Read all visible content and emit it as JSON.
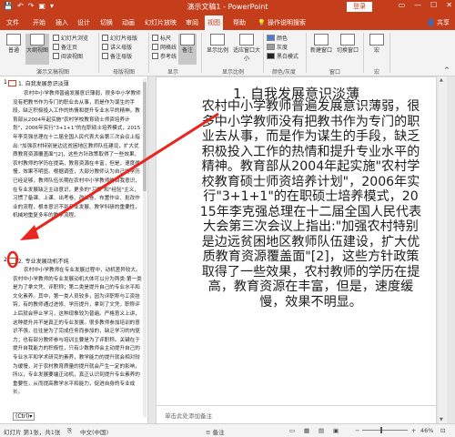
{
  "titlebar": {
    "title": "演示文稿1 - PowerPoint",
    "quick_access": [
      "💾",
      "↶",
      "↷",
      "▣",
      "▾"
    ],
    "login": "登录",
    "controls": [
      "▭",
      "—",
      "☐",
      "✕"
    ]
  },
  "tabs": {
    "items": [
      "文件",
      "开始",
      "插入",
      "设计",
      "切换",
      "动画",
      "幻灯片放映",
      "审阅",
      "视图",
      "帮助"
    ],
    "active": "视图",
    "tell_me": "操作说明搜索",
    "share": "共享"
  },
  "ribbon": {
    "view_buttons": [
      "普通",
      "大纲视图",
      "备注页"
    ],
    "view_checks": [
      "幻灯片浏览",
      "阅读视图"
    ],
    "group_pres_view": "演示文稿视图",
    "master_checks": [
      "幻灯片母版",
      "讲义母版",
      "备注母版"
    ],
    "group_master": "母版视图",
    "show_checks": [
      "标尺",
      "网格线",
      "参考线"
    ],
    "group_show": "显示",
    "notes_button": "备注",
    "zoom_buttons": [
      "显示比例",
      "适应窗口大小"
    ],
    "group_zoom": "显示比例",
    "color_items": [
      "颜色",
      "灰度",
      "黑白模式"
    ],
    "group_color": "颜色/灰度",
    "window_buttons": [
      "新建窗口",
      "切换窗口"
    ],
    "group_window": "窗口",
    "macro_button": "宏",
    "group_macro": "宏"
  },
  "outline": {
    "slide1_num": "1",
    "slide1_title": "1. 自我发展意识淡薄",
    "slide1_body": "农村中小学教师普遍发展意识薄弱，很多中小学教师没有把教书作为专门的职业去从事，而是作为谋生的手段，缺乏积极投入工作的热情和提升专业水平的精神。教育部从2004年起实施\"农村学校教育硕士师资培养计划\"，2006年实行\"3+1+1\"的在职硕士培养模式，2015年李克强总理在十二届全国人民代表大会第三次会议上指出:\"加强农村特别是边远贫困地区教师队伍建设，扩大优质教育资源覆盖面\"[2]，这些方针政策取得了一些效果，农村教师的学历在提高，教育资源在丰富，但是，速度缓慢，效果不明显。根据调查，大部分教师认为自己的学历已经足够，教师队伍长期在农村中小学教师的自我意识，在专业发展缺乏主动意识，更多的\"习惯\"和\"经验\"主义，习惯了备课、上课、出考卷、改试卷、布置作业、批改作业的流程，根本意识不到专业发展、教学科研的重要性，机械地重复多年的教学流程。",
    "slide2_num": "2",
    "slide2_title": "2. 专业发展动机不纯",
    "slide2_body": "农村中小学教师在专业发展过程中，动机差异较大。农村中小学教师的专业发展动机大体可以分为两类:第一类是为了拿文凭、评职称；第二类是提升自己的专业水平和文化素养。其中，第一类人员较多，因为评职称与工资挂钩，有的教师通过进修、学历提升，拿到了文凭，职称评上后就会停止学习，这种现象较为普遍。严格意义上讲，这种提升并不是真正的专业发展。很多教师参加培训的意识不强，往往是为了完成任务而参加的，缺乏学习的内驱力；也有部分教师参与培训主要是为了评职称。关键在于提升自我能力的积极性，只有少数教师会主动提升自己的专业水平和学术研究的素养，教学能力的提升就会相对较为缓慢，对于农村教育质量的提升就会产生一定的影响，所以，专业发展要端正动机，真正认识到提升专业素养的重要性，从而提高教学水平和能力，促进自身的专业成长。",
    "ctrl_tag": "(Ctrl)▾"
  },
  "slide": {
    "title": "1. 自我发展意识淡薄",
    "body": "农村中小学教师普遍发展意识薄弱，很多中小学教师没有把教书作为专门的职业去从事，而是作为谋生的手段，缺乏积极投入工作的热情和提升专业水平的精神。教育部从2004年起实施\"农村学校教育硕士师资培养计划\"，2006年实行\"3+1+1\"的在职硕士培养模式，2015年李克强总理在十二届全国人民代表大会第三次会议上指出:\"加强农村特别是边远贫困地区教师队伍建设，扩大优质教育资源覆盖面\"[2]，这些方针政策取得了一些效果，农村教师的学历在提高，教育资源在丰富，但是，速度缓慢，效果不明显。"
  },
  "notes": {
    "placeholder": "单击此处添加备注"
  },
  "status": {
    "slide_info": "幻灯片 第1张，共1张",
    "language": "中文(中国)",
    "notes_label": "≡ 备注",
    "zoom_minus": "−",
    "zoom_plus": "+",
    "zoom": "46%"
  },
  "colors": {
    "accent": "#c43e1c",
    "annotation": "#e8261f"
  }
}
